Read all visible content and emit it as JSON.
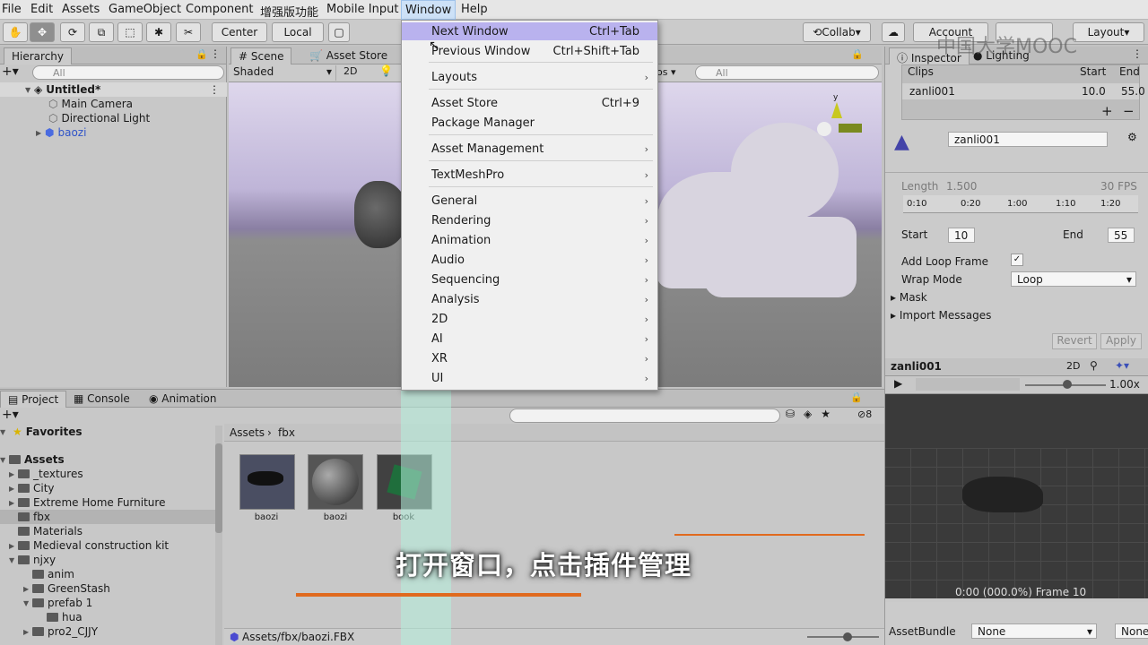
{
  "menubar": [
    "File",
    "Edit",
    "Assets",
    "GameObject",
    "Component",
    "增强版功能",
    "Mobile Input",
    "Window",
    "Help"
  ],
  "toolbar": {
    "center": "Center",
    "local": "Local",
    "collab": "Collab",
    "account": "Account",
    "layout": "Layout"
  },
  "watermark": "中国大学MOOC",
  "hierarchy": {
    "tab": "Hierarchy",
    "search": "All",
    "scene": "Untitled*",
    "items": [
      "Main Camera",
      "Directional Light",
      "baozi"
    ]
  },
  "scene": {
    "tabs": [
      "Scene",
      "Asset Store"
    ],
    "shading": "Shaded",
    "mode2d": "2D",
    "gizmos": "os",
    "search": "All"
  },
  "window_menu": {
    "items": [
      {
        "label": "Next Window",
        "shortcut": "Ctrl+Tab"
      },
      {
        "label": "Previous Window",
        "shortcut": "Ctrl+Shift+Tab"
      },
      {
        "label": "Layouts",
        "shortcut": ""
      },
      {
        "label": "Asset Store",
        "shortcut": "Ctrl+9"
      },
      {
        "label": "Package Manager",
        "shortcut": ""
      },
      {
        "label": "Asset Management",
        "shortcut": ""
      },
      {
        "label": "TextMeshPro",
        "shortcut": ""
      },
      {
        "label": "General",
        "shortcut": ""
      },
      {
        "label": "Rendering",
        "shortcut": ""
      },
      {
        "label": "Animation",
        "shortcut": ""
      },
      {
        "label": "Audio",
        "shortcut": ""
      },
      {
        "label": "Sequencing",
        "shortcut": ""
      },
      {
        "label": "Analysis",
        "shortcut": ""
      },
      {
        "label": "2D",
        "shortcut": ""
      },
      {
        "label": "AI",
        "shortcut": ""
      },
      {
        "label": "XR",
        "shortcut": ""
      },
      {
        "label": "UI",
        "shortcut": ""
      }
    ]
  },
  "inspector": {
    "tabs": [
      "Inspector",
      "Lighting"
    ],
    "clips_header": {
      "name": "Clips",
      "start": "Start",
      "end": "End"
    },
    "clip": {
      "name": "zanli001",
      "start": "10.0",
      "end": "55.0"
    },
    "clip_name": "zanli001",
    "length_label": "Length",
    "length": "1.500",
    "fps": "30 FPS",
    "timeline": [
      "0:10",
      "0:20",
      "1:00",
      "1:10",
      "1:20"
    ],
    "start_label": "Start",
    "start": "10",
    "end_label": "End",
    "end": "55",
    "loop_frame": "Add Loop Frame",
    "wrap_mode_label": "Wrap Mode",
    "wrap_mode": "Loop",
    "mask": "Mask",
    "import_messages": "Import Messages",
    "revert": "Revert",
    "apply": "Apply"
  },
  "preview": {
    "clip": "zanli001",
    "mode2d": "2D",
    "speed": "1.00x",
    "status": "0:00 (000.0%) Frame 10",
    "assetbundle_label": "AssetBundle",
    "assetbundle": "None",
    "variant": "None"
  },
  "project": {
    "tabs": [
      "Project",
      "Console",
      "Animation"
    ],
    "favorites": "Favorites",
    "assets_root": "Assets",
    "folders": [
      "_textures",
      "City",
      "Extreme Home Furniture",
      "fbx",
      "Materials",
      "Medieval construction kit",
      "njxy",
      "anim",
      "GreenStash",
      "prefab 1",
      "hua",
      "pro2_CJJY"
    ],
    "breadcrumb": [
      "Assets",
      "fbx"
    ],
    "assets": [
      "baozi",
      "baozi",
      "book"
    ],
    "path": "Assets/fbx/baozi.FBX",
    "badge": "8"
  },
  "subtitle": "打开窗口，点击插件管理",
  "colors": {
    "menu_highlight": "#b9b2ee",
    "sky": "#bfb5d8",
    "accent_line": "#e06a1e"
  }
}
